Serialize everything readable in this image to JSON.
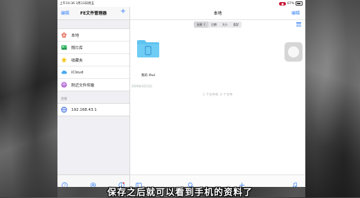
{
  "status_bar": {
    "time": "上午10:36",
    "date": "3月13日周五",
    "rec": "●",
    "battery": "67%"
  },
  "sidebar": {
    "edit_label": "编辑",
    "title": "FE文件管理器",
    "add_label": "+",
    "items": [
      {
        "label": "本地",
        "icon": "home-icon"
      },
      {
        "label": "照片库",
        "icon": "photos-icon"
      },
      {
        "label": "收藏夹",
        "icon": "star-icon"
      },
      {
        "label": "iCloud",
        "icon": "cloud-icon"
      },
      {
        "label": "附近文件传输",
        "icon": "wifi-icon"
      }
    ],
    "section_label": "连接",
    "connections": [
      {
        "label": "192.168.43.1",
        "icon": "globe-icon"
      }
    ]
  },
  "main": {
    "title": "本地",
    "edit_label": "编辑",
    "sort_options": [
      "名称 ↑",
      "日期",
      "大小",
      "类型"
    ],
    "folder": {
      "name": "我的 iPad",
      "date": "2020年3月13日"
    },
    "summary": "1 个文件夹, 0 个文件"
  },
  "subtitle": "保存之后就可以看到手机的资料了",
  "colors": {
    "accent": "#2f7cf6",
    "folder": "#5fc3ef"
  }
}
